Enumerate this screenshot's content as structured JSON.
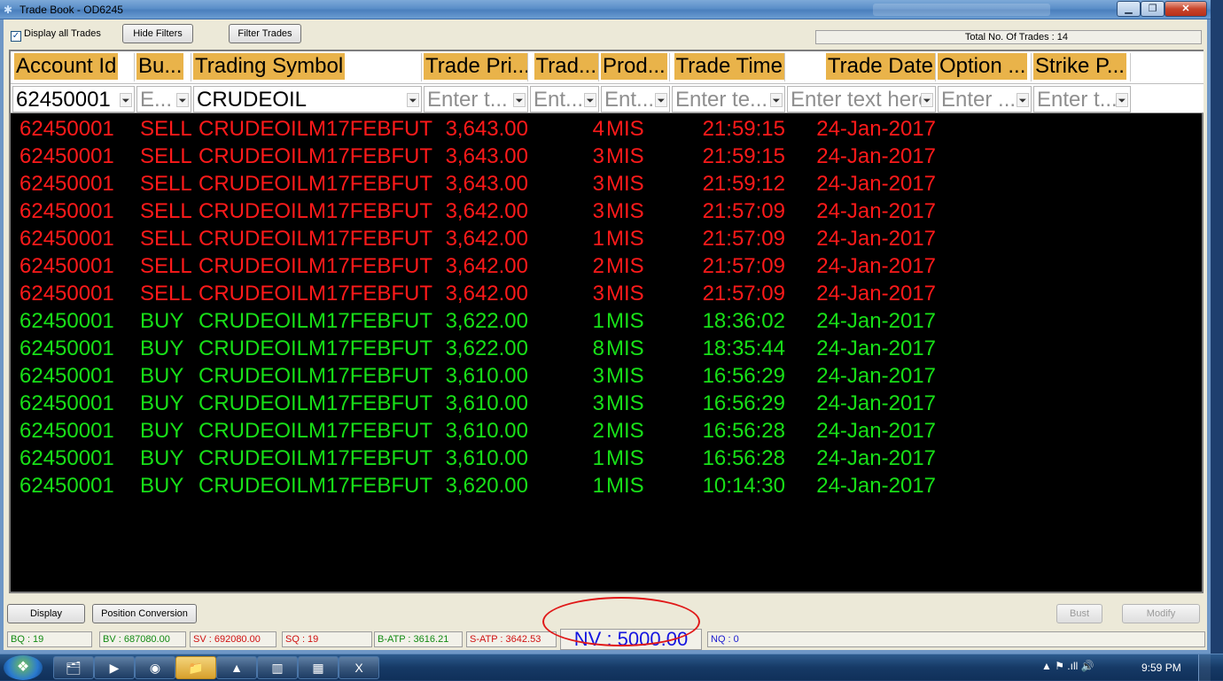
{
  "window": {
    "title": "Trade Book - OD6245",
    "minimize_label": "▁",
    "maximize_label": "❐",
    "close_label": "✕"
  },
  "toolbar": {
    "display_all_label": "Display all Trades",
    "display_all_checked": true,
    "hide_filters_label": "Hide Filters",
    "filter_trades_label": "Filter Trades",
    "total_label": "Total No. Of Trades : 14"
  },
  "columns": [
    {
      "label": "Account Id",
      "filter_value": "62450001",
      "filter_placeholder": ""
    },
    {
      "label": "Bu...",
      "filter_value": "",
      "filter_placeholder": "E..."
    },
    {
      "label": "Trading Symbol",
      "filter_value": "CRUDEOIL",
      "filter_placeholder": ""
    },
    {
      "label": "Trade Pri...",
      "filter_value": "",
      "filter_placeholder": "Enter t..."
    },
    {
      "label": "Trad...",
      "filter_value": "",
      "filter_placeholder": "Ent..."
    },
    {
      "label": "Prod...",
      "filter_value": "",
      "filter_placeholder": "Ent..."
    },
    {
      "label": "Trade Time",
      "filter_value": "",
      "filter_placeholder": "Enter te..."
    },
    {
      "label": "Trade Date",
      "filter_value": "",
      "filter_placeholder": "Enter text here"
    },
    {
      "label": "Option ...",
      "filter_value": "",
      "filter_placeholder": "Enter ..."
    },
    {
      "label": "Strike P...",
      "filter_value": "",
      "filter_placeholder": "Enter t..."
    }
  ],
  "trades": [
    {
      "account": "62450001",
      "side": "SELL",
      "symbol": "CRUDEOILM17FEBFUT",
      "price": "3,643.00",
      "qty": "4",
      "product": "MIS",
      "time": "21:59:15",
      "date": "24-Jan-2017"
    },
    {
      "account": "62450001",
      "side": "SELL",
      "symbol": "CRUDEOILM17FEBFUT",
      "price": "3,643.00",
      "qty": "3",
      "product": "MIS",
      "time": "21:59:15",
      "date": "24-Jan-2017"
    },
    {
      "account": "62450001",
      "side": "SELL",
      "symbol": "CRUDEOILM17FEBFUT",
      "price": "3,643.00",
      "qty": "3",
      "product": "MIS",
      "time": "21:59:12",
      "date": "24-Jan-2017"
    },
    {
      "account": "62450001",
      "side": "SELL",
      "symbol": "CRUDEOILM17FEBFUT",
      "price": "3,642.00",
      "qty": "3",
      "product": "MIS",
      "time": "21:57:09",
      "date": "24-Jan-2017"
    },
    {
      "account": "62450001",
      "side": "SELL",
      "symbol": "CRUDEOILM17FEBFUT",
      "price": "3,642.00",
      "qty": "1",
      "product": "MIS",
      "time": "21:57:09",
      "date": "24-Jan-2017"
    },
    {
      "account": "62450001",
      "side": "SELL",
      "symbol": "CRUDEOILM17FEBFUT",
      "price": "3,642.00",
      "qty": "2",
      "product": "MIS",
      "time": "21:57:09",
      "date": "24-Jan-2017"
    },
    {
      "account": "62450001",
      "side": "SELL",
      "symbol": "CRUDEOILM17FEBFUT",
      "price": "3,642.00",
      "qty": "3",
      "product": "MIS",
      "time": "21:57:09",
      "date": "24-Jan-2017"
    },
    {
      "account": "62450001",
      "side": "BUY",
      "symbol": "CRUDEOILM17FEBFUT",
      "price": "3,622.00",
      "qty": "1",
      "product": "MIS",
      "time": "18:36:02",
      "date": "24-Jan-2017"
    },
    {
      "account": "62450001",
      "side": "BUY",
      "symbol": "CRUDEOILM17FEBFUT",
      "price": "3,622.00",
      "qty": "8",
      "product": "MIS",
      "time": "18:35:44",
      "date": "24-Jan-2017"
    },
    {
      "account": "62450001",
      "side": "BUY",
      "symbol": "CRUDEOILM17FEBFUT",
      "price": "3,610.00",
      "qty": "3",
      "product": "MIS",
      "time": "16:56:29",
      "date": "24-Jan-2017"
    },
    {
      "account": "62450001",
      "side": "BUY",
      "symbol": "CRUDEOILM17FEBFUT",
      "price": "3,610.00",
      "qty": "3",
      "product": "MIS",
      "time": "16:56:29",
      "date": "24-Jan-2017"
    },
    {
      "account": "62450001",
      "side": "BUY",
      "symbol": "CRUDEOILM17FEBFUT",
      "price": "3,610.00",
      "qty": "2",
      "product": "MIS",
      "time": "16:56:28",
      "date": "24-Jan-2017"
    },
    {
      "account": "62450001",
      "side": "BUY",
      "symbol": "CRUDEOILM17FEBFUT",
      "price": "3,610.00",
      "qty": "1",
      "product": "MIS",
      "time": "16:56:28",
      "date": "24-Jan-2017"
    },
    {
      "account": "62450001",
      "side": "BUY",
      "symbol": "CRUDEOILM17FEBFUT",
      "price": "3,620.00",
      "qty": "1",
      "product": "MIS",
      "time": "10:14:30",
      "date": "24-Jan-2017"
    }
  ],
  "bottom_buttons": {
    "display_label": "Display",
    "position_conversion_label": "Position Conversion",
    "bust_label": "Bust",
    "modify_label": "Modify"
  },
  "status": {
    "bq": "BQ : 19",
    "bv": "BV : 687080.00",
    "sv": "SV : 692080.00",
    "sq": "SQ : 19",
    "batp": "B-ATP : 3616.21",
    "satp": "S-ATP : 3642.53",
    "nv": "NV : 5000.00",
    "nq": "NQ : 0"
  },
  "taskbar": {
    "start_icon": "windows-orb",
    "items": [
      {
        "name": "explorer-icon",
        "glyph": "🗂"
      },
      {
        "name": "media-player-icon",
        "glyph": "▶"
      },
      {
        "name": "chrome-icon",
        "glyph": "◉"
      },
      {
        "name": "folder-icon",
        "glyph": "📁"
      },
      {
        "name": "triangle-app-icon",
        "glyph": "▲"
      },
      {
        "name": "chart-app-icon",
        "glyph": "▥"
      },
      {
        "name": "calculator-icon",
        "glyph": "▦"
      },
      {
        "name": "excel-icon",
        "glyph": "X"
      }
    ],
    "tray_text": "▲  ⚑  .ıll  🔊",
    "clock": "9:59 PM"
  },
  "colors": {
    "sell": "#ff1a1a",
    "buy": "#18e018",
    "header": "#e9b34a",
    "grid_bg": "#000000"
  }
}
